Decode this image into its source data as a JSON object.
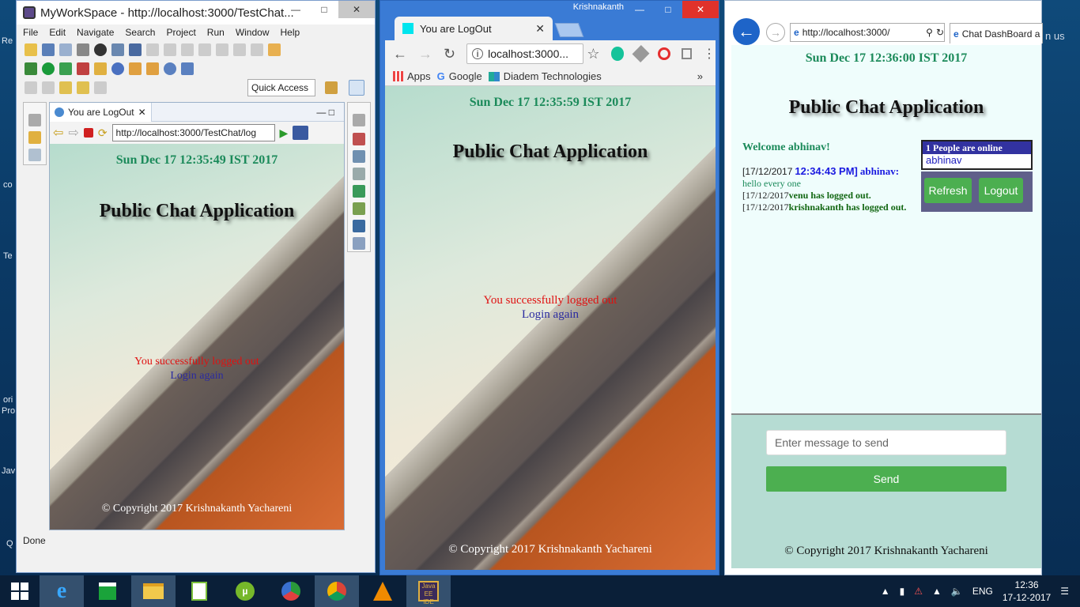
{
  "eclipse": {
    "title": "MyWorkSpace - http://localhost:3000/TestChat...",
    "menu": [
      "File",
      "Edit",
      "Navigate",
      "Search",
      "Project",
      "Run",
      "Window",
      "Help"
    ],
    "quick_access": "Quick Access",
    "view_tab": "You are LogOut",
    "url": "http://localhost:3000/TestChat/log",
    "status": "Done",
    "page": {
      "clock": "Sun Dec 17 12:35:49 IST 2017",
      "title": "Public Chat Application",
      "message": "You successfully logged out",
      "link": "Login again",
      "copyright": "© Copyright 2017 Krishnakanth Yachareni"
    }
  },
  "chrome": {
    "user": "Krishnakanth",
    "tab_title": "You are LogOut",
    "url": "localhost:3000...",
    "bookmarks": [
      "Apps",
      "Google",
      "Diadem Technologies"
    ],
    "page": {
      "clock": "Sun Dec 17 12:35:59 IST 2017",
      "title": "Public Chat Application",
      "message": "You successfully logged out",
      "link": "Login again",
      "copyright": "© Copyright 2017 Krishnakanth Yachareni"
    }
  },
  "ie": {
    "url": "http://localhost:3000/",
    "tab_title": "Chat DashBoard a",
    "page": {
      "clock": "Sun Dec 17 12:36:00 IST 2017",
      "title": "Public Chat Application",
      "welcome": "Welcome abhinav!",
      "messages": {
        "m1_date": "[17/12/2017",
        "m1_time": "12:34:43 PM]",
        "m1_user": "abhinav:",
        "m1_text": "hello every one",
        "m2_date": "[17/12/2017",
        "m2_text": "venu has logged out.",
        "m3_date": "[17/12/2017",
        "m3_text": "krishnakanth has logged out."
      },
      "online_header": "1 People are online",
      "online_user": "abhinav",
      "refresh": "Refresh",
      "logout": "Logout",
      "message_placeholder": "Enter message to send",
      "send": "Send",
      "copyright": "© Copyright 2017 Krishnakanth Yachareni"
    }
  },
  "taskbar": {
    "lang": "ENG",
    "time": "12:36",
    "date": "17-12-2017"
  },
  "colors": {
    "clock_green": "#1b8a5a",
    "logout_red": "#e01010",
    "button_green": "#4caf50",
    "desktop_blue": "#0b3a66"
  }
}
